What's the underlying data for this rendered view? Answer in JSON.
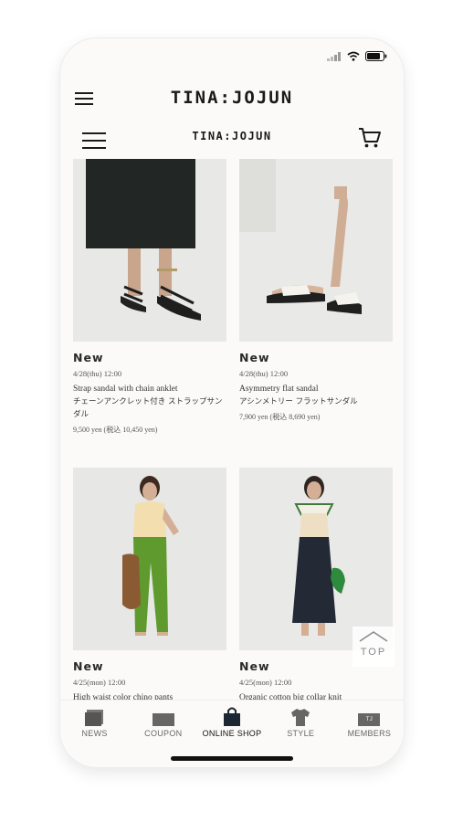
{
  "app": {
    "brand": "TINA:JOJUN"
  },
  "web": {
    "brand": "TINA:JOJUN"
  },
  "products": [
    {
      "badge": "New",
      "date": "4/28(thu) 12:00",
      "name_en": "Strap sandal with chain anklet",
      "name_jp": "チェーンアンクレット付き ストラップサンダル",
      "price": "9,500 yen (税込 10,450 yen)"
    },
    {
      "badge": "New",
      "date": "4/28(thu) 12:00",
      "name_en": "Asymmetry flat sandal",
      "name_jp": "アシンメトリー フラットサンダル",
      "price": "7,900 yen (税込 8,690 yen)"
    },
    {
      "badge": "New",
      "date": "4/25(mon) 12:00",
      "name_en": "High waist color chino pants",
      "name_jp": "",
      "price": ""
    },
    {
      "badge": "New",
      "date": "4/25(mon) 12:00",
      "name_en": "Organic cotton big collar knit",
      "name_jp": "",
      "price": ""
    }
  ],
  "top_button": {
    "label": "TOP"
  },
  "tabs": [
    {
      "label": "NEWS",
      "icon": "news-icon"
    },
    {
      "label": "COUPON",
      "icon": "coupon-icon"
    },
    {
      "label": "ONLINE SHOP",
      "icon": "shopping-bag-icon",
      "active": true
    },
    {
      "label": "STYLE",
      "icon": "tshirt-icon"
    },
    {
      "label": "MEMBERS",
      "icon": "member-card-icon",
      "badge": "TJ"
    }
  ],
  "colors": {
    "background": "#fbfaf8",
    "text": "#1a1a1a",
    "photo_bg": "#e9e9e7",
    "accent_green": "#5e9a2e"
  }
}
